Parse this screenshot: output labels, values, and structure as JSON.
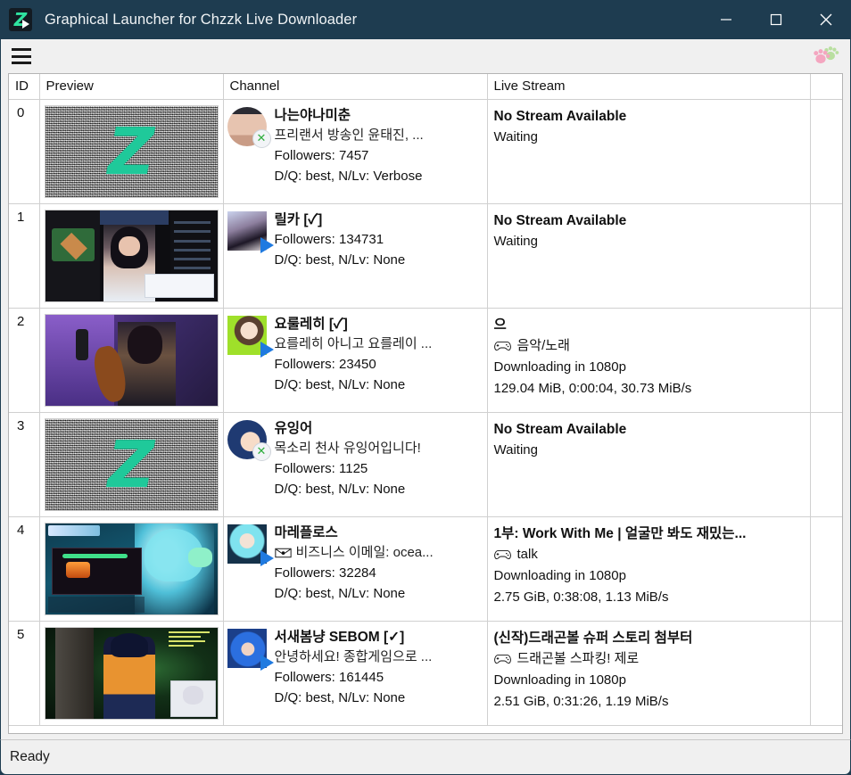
{
  "window": {
    "title": "Graphical Launcher for Chzzk Live Downloader",
    "app_icon": "lightning-z-play-icon",
    "minimize_label": "Minimize",
    "maximize_label": "Maximize",
    "close_label": "Close"
  },
  "toolbar": {
    "menu_icon": "hamburger-menu-icon",
    "paw_icon": "paw-prints-icon",
    "paw_color_primary": "#f4a6c0",
    "paw_color_secondary": "#b9dfa0"
  },
  "table": {
    "headers": [
      "ID",
      "Preview",
      "Channel",
      "Live Stream",
      ""
    ],
    "rows": [
      {
        "id": "0",
        "preview": {
          "kind": "noise",
          "glyph": "Z"
        },
        "channel": {
          "avatar_shape": "circle",
          "avatar_kind": "photo-selfie",
          "badge": "offline",
          "name": "나는야나미춘",
          "desc": "프리랜서 방송인 윤태진, ...",
          "desc_icon": "",
          "followers": "Followers: 7457",
          "dq": "D/Q: best, N/Lv: Verbose"
        },
        "live": {
          "title": "No Stream Available",
          "category": "",
          "category_icon": "",
          "state": "Waiting",
          "stats": ""
        }
      },
      {
        "id": "1",
        "preview": {
          "kind": "baseball",
          "glyph": ""
        },
        "channel": {
          "avatar_shape": "square",
          "avatar_kind": "photo-portrait",
          "badge": "live",
          "name": "릴카 [✓]",
          "desc": "",
          "desc_icon": "",
          "followers": "Followers: 134731",
          "dq": "D/Q: best, N/Lv: None"
        },
        "live": {
          "title": "No Stream Available",
          "category": "",
          "category_icon": "",
          "state": "Waiting",
          "stats": ""
        }
      },
      {
        "id": "2",
        "preview": {
          "kind": "cello",
          "glyph": ""
        },
        "channel": {
          "avatar_shape": "square",
          "avatar_kind": "art-cello-girl",
          "badge": "live",
          "name": "요룰레히 [✓]",
          "desc": "요를레히 아니고 요를레이 ...",
          "desc_icon": "",
          "followers": "Followers: 23450",
          "dq": "D/Q: best, N/Lv: None"
        },
        "live": {
          "title": "으",
          "category": "음악/노래",
          "category_icon": "gamepad-icon",
          "state": "Downloading in 1080p",
          "stats": "129.04 MiB, 0:00:04, 30.73 MiB/s"
        }
      },
      {
        "id": "3",
        "preview": {
          "kind": "noise",
          "glyph": "Z"
        },
        "channel": {
          "avatar_shape": "circle",
          "avatar_kind": "art-blue-hair-girl",
          "badge": "offline",
          "name": "유잉어",
          "desc": "목소리 천사 유잉어입니다!",
          "desc_icon": "",
          "followers": "Followers: 1125",
          "dq": "D/Q: best, N/Lv: None"
        },
        "live": {
          "title": "No Stream Available",
          "category": "",
          "category_icon": "",
          "state": "Waiting",
          "stats": ""
        }
      },
      {
        "id": "4",
        "preview": {
          "kind": "game",
          "glyph": ""
        },
        "channel": {
          "avatar_shape": "square",
          "avatar_kind": "art-cyan-hair-girl",
          "badge": "live",
          "name": "마레플로스",
          "desc": "비즈니스 이메일: ocea...",
          "desc_icon": "envelope-icon",
          "followers": "Followers: 32284",
          "dq": "D/Q: best, N/Lv: None"
        },
        "live": {
          "title": "1부: Work With Me | 얼굴만 봐도 재밌는...",
          "category": "talk",
          "category_icon": "gamepad-icon",
          "state": "Downloading in 1080p",
          "stats": "2.75 GiB, 0:38:08, 1.13 MiB/s"
        }
      },
      {
        "id": "5",
        "preview": {
          "kind": "dbz",
          "glyph": ""
        },
        "channel": {
          "avatar_shape": "square",
          "avatar_kind": "photo-blue-wig",
          "badge": "live",
          "name": "서새봄냥 SEBOM [✓]",
          "desc": "안녕하세요! 종합게임으로 ...",
          "desc_icon": "",
          "followers": "Followers: 161445",
          "dq": "D/Q: best, N/Lv: None"
        },
        "live": {
          "title": "(신작)드래곤볼 슈퍼 스토리 첨부터",
          "category": "드래곤볼 스파킹! 제로",
          "category_icon": "gamepad-icon",
          "state": "Downloading in 1080p",
          "stats": "2.51 GiB, 0:31:26, 1.19 MiB/s"
        }
      }
    ]
  },
  "statusbar": {
    "text": "Ready"
  }
}
